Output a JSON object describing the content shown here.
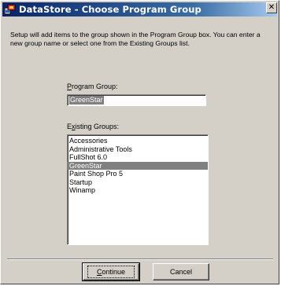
{
  "window": {
    "title": "DataStore - Choose Program Group",
    "close_glyph": "✕"
  },
  "intro": {
    "text": "Setup will add items to the group shown in the Program Group box. You can enter a new group name or select one from the Existing Groups list."
  },
  "program_group": {
    "label_accel": "P",
    "label_rest": "rogram Group:",
    "value": "GreenStar"
  },
  "existing_groups": {
    "label_first": "E",
    "label_accel": "x",
    "label_rest": "isting Groups:",
    "items": [
      "Accessories",
      "Administrative Tools",
      "FullShot 6.0",
      "GreenStar",
      "Paint Shop Pro 5",
      "Startup",
      "Winamp"
    ],
    "selected": "GreenStar"
  },
  "buttons": {
    "continue_accel": "C",
    "continue_rest": "ontinue",
    "cancel": "Cancel"
  },
  "colors": {
    "title_bar": "#0a246a",
    "selection": "#808080",
    "dialog_face": "#d4d0c8"
  }
}
